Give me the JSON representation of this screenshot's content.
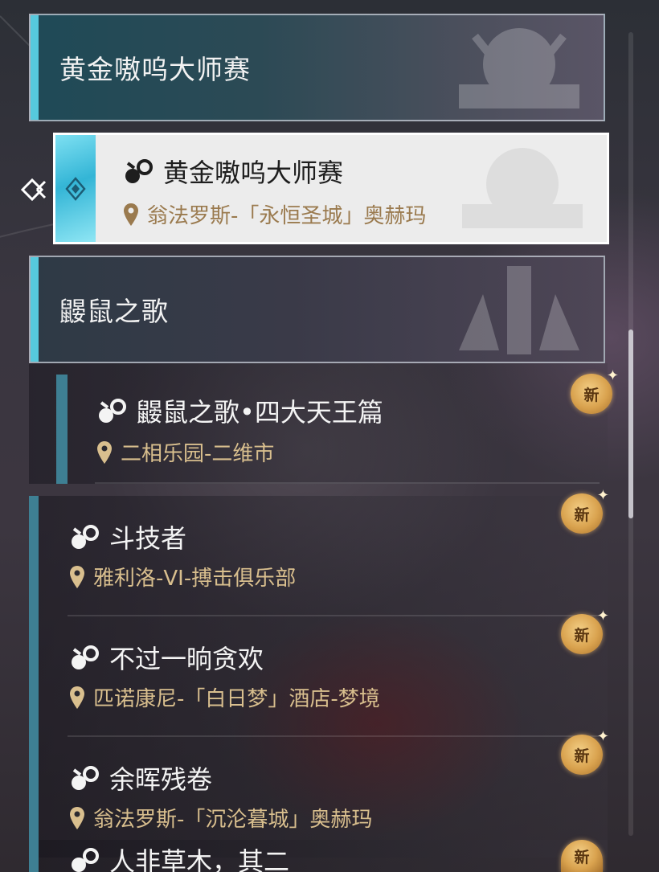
{
  "groups": [
    {
      "title": "黄金嗷呜大师赛"
    },
    {
      "title": "鼹鼠之歌"
    }
  ],
  "selected_quest": {
    "title": "黄金嗷呜大师赛",
    "location": "翁法罗斯-「永恒圣城」奥赫玛"
  },
  "quests": [
    {
      "title": "鼹鼠之歌•四大天王篇",
      "location": "二相乐园-二维市",
      "badge": "新"
    },
    {
      "title": "斗技者",
      "location": "雅利洛-VI-搏击俱乐部",
      "badge": "新"
    },
    {
      "title": "不过一晌贪欢",
      "location": "匹诺康尼-「白日梦」酒店-梦境",
      "badge": "新"
    },
    {
      "title": "余晖残卷",
      "location": "翁法罗斯-「沉沦暮城」奥赫玛",
      "badge": "新"
    },
    {
      "title": "人非草木，其二",
      "location": "",
      "badge": "新"
    }
  ],
  "icons": {
    "quest": "quest-icon",
    "pin": "location-pin-icon",
    "selector": "selector-arrow-icon"
  },
  "colors": {
    "accent_cyan": "#56c9dd",
    "quest_bar": "#3e7f93",
    "location_gold": "#d9bf8e",
    "badge_gold": "#d9a24e"
  }
}
